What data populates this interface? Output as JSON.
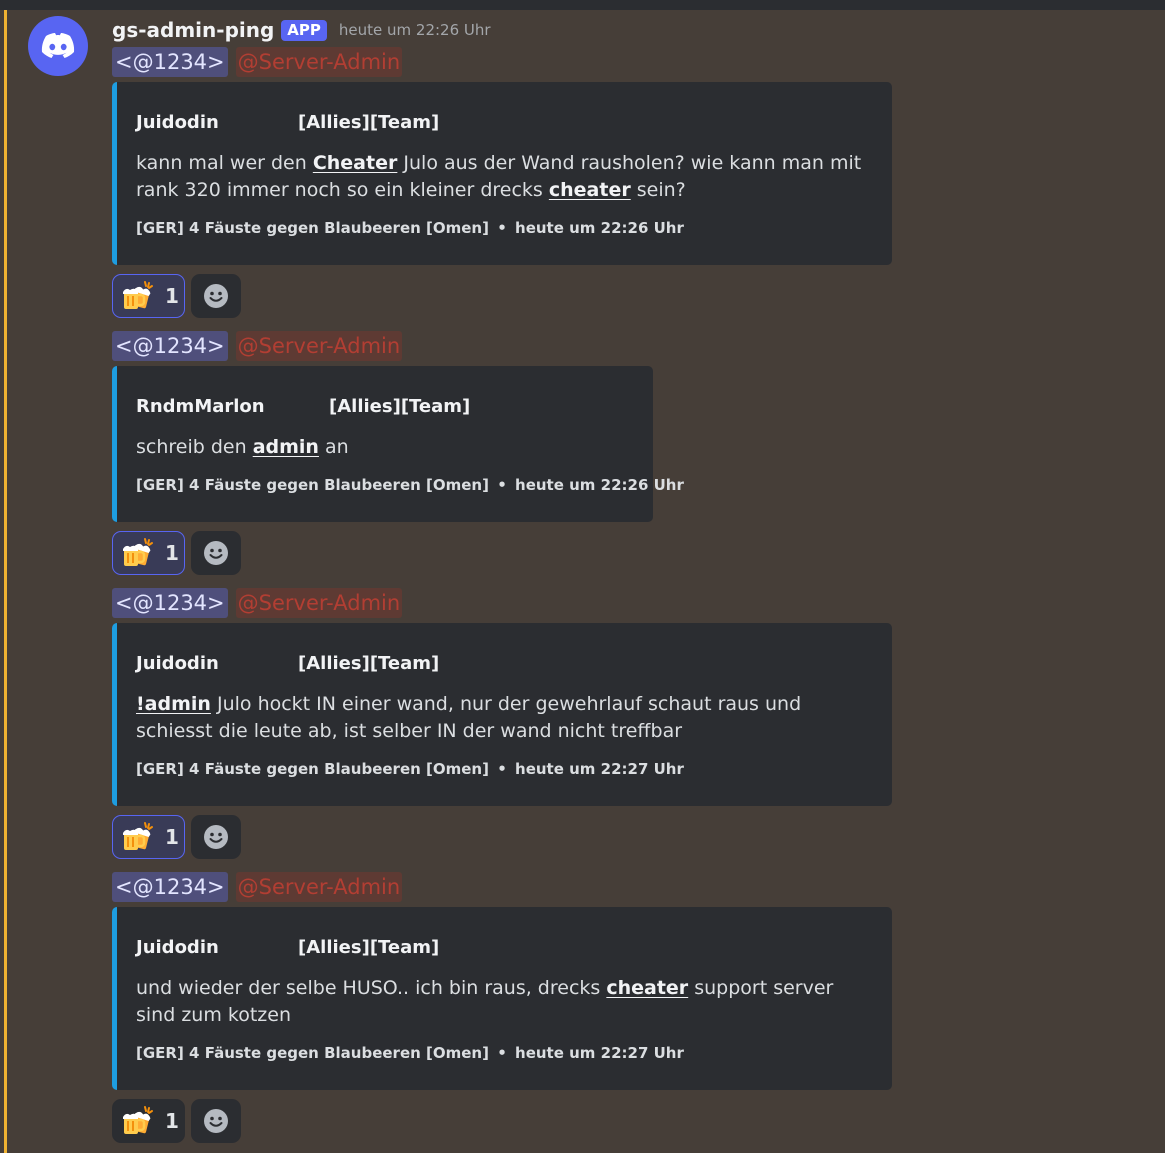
{
  "header": {
    "username": "gs-admin-ping",
    "badge": "APP",
    "timestamp": "heute um 22:26 Uhr"
  },
  "colors": {
    "embed_accent": "#1e9de0",
    "blurple": "#5865f2",
    "mention_highlight": "#f0b232",
    "role_mention_text": "#b23e33"
  },
  "messages": [
    {
      "user_mention": "<@1234>",
      "role_mention": "@Server-Admin",
      "author": "Juidodin",
      "team": "[Allies][Team]",
      "desc": {
        "p1": "kann mal wer den ",
        "k1": "Cheater",
        "p2": " Julo aus der Wand rausholen? wie kann man mit rank 320 immer noch so ein kleiner drecks ",
        "k2": "cheater",
        "p3": " sein?"
      },
      "server": "[GER] 4 Fäuste gegen Blaubeeren  [Omen]",
      "sep": "•",
      "time": "heute um 22:26 Uhr",
      "reaction_icon": "beer-mugs-icon",
      "reaction_count": "1"
    },
    {
      "user_mention": "<@1234>",
      "role_mention": "@Server-Admin",
      "author": "RndmMarlon",
      "team": "[Allies][Team]",
      "desc": {
        "p1": "schreib den ",
        "k1": "admin",
        "p2": " an"
      },
      "server": "[GER] 4 Fäuste gegen Blaubeeren  [Omen]",
      "sep": "•",
      "time": "heute um 22:26 Uhr",
      "reaction_icon": "beer-mugs-icon",
      "reaction_count": "1"
    },
    {
      "user_mention": "<@1234>",
      "role_mention": "@Server-Admin",
      "author": "Juidodin",
      "team": "[Allies][Team]",
      "desc": {
        "k1": "!admin",
        "p1": " Julo hockt IN einer wand, nur der gewehrlauf schaut raus und schiesst die leute ab, ist selber IN der wand nicht treffbar"
      },
      "server": "[GER] 4 Fäuste gegen Blaubeeren  [Omen]",
      "sep": "•",
      "time": "heute um 22:27 Uhr",
      "reaction_icon": "beer-mugs-icon",
      "reaction_count": "1"
    },
    {
      "user_mention": "<@1234>",
      "role_mention": "@Server-Admin",
      "author": "Juidodin",
      "team": "[Allies][Team]",
      "desc": {
        "p1": "und wieder der selbe HUSO.. ich bin raus, drecks ",
        "k1": "cheater",
        "p2": " support server sind zum kotzen"
      },
      "server": "[GER] 4 Fäuste gegen Blaubeeren  [Omen]",
      "sep": "•",
      "time": "heute um 22:27 Uhr",
      "reaction_icon": "beer-mugs-icon",
      "reaction_count": "1"
    }
  ]
}
